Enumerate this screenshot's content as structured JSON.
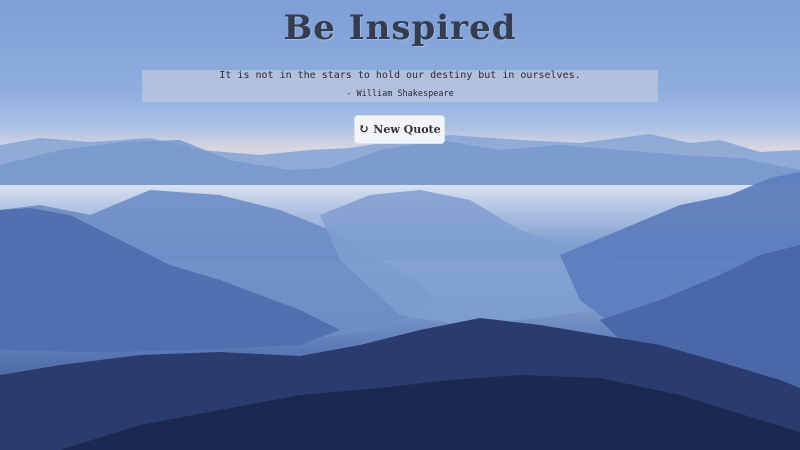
{
  "header": {
    "title": "Be Inspired"
  },
  "quote": {
    "text": "It is not in the stars to hold our destiny but in ourselves.",
    "author": "- William Shakespeare"
  },
  "actions": {
    "new_quote_label": "New Quote",
    "new_quote_icon": "refresh-icon"
  },
  "background": {
    "subject": "misty-blue-mountain-ranges",
    "colors": {
      "sky": "#7d9fd6",
      "haze": "#d8d6e0",
      "mid_ridge": "#5a79b4",
      "dark_ridge": "#1f2f5a"
    }
  }
}
